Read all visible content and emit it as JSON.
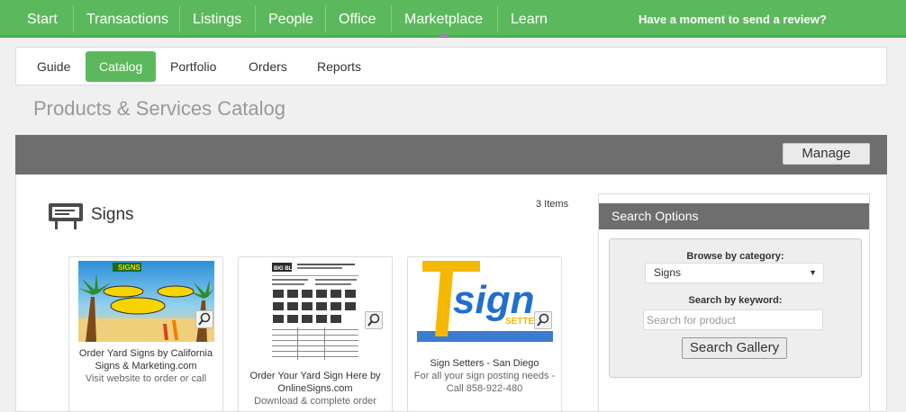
{
  "topnav": {
    "items": [
      "Start",
      "Transactions",
      "Listings",
      "People",
      "Office",
      "Marketplace",
      "Learn"
    ],
    "review_text": "Have a moment to send a review?"
  },
  "subnav": {
    "tabs": [
      "Guide",
      "Catalog",
      "Portfolio",
      "Orders",
      "Reports"
    ],
    "active": "Catalog"
  },
  "page_title": "Products & Services Catalog",
  "panel": {
    "manage_label": "Manage"
  },
  "section": {
    "title": "Signs",
    "icon": "billboard-icon",
    "count_text": "3 Items"
  },
  "cards": [
    {
      "title": "Order Yard Signs by California Signs & Marketing.com",
      "desc": "Visit website to order or call",
      "thumb_text": "SIGNS"
    },
    {
      "title": "Order Your Yard Sign Here by OnlineSigns.com",
      "desc": "Download & complete order",
      "thumb_text": "BIG BLOCK"
    },
    {
      "title": "Sign Setters - San Diego",
      "desc": "For all your sign posting needs - Call 858-922-480",
      "thumb_text": "sign",
      "thumb_subtext": "SETTE"
    }
  ],
  "search": {
    "header": "Search Options",
    "browse_label": "Browse by category:",
    "category_value": "Signs",
    "keyword_label": "Search by keyword:",
    "keyword_placeholder": "Search for product",
    "button_label": "Search Gallery"
  },
  "colors": {
    "brand_green": "#5cb85c",
    "header_gray": "#6e6e6e"
  }
}
